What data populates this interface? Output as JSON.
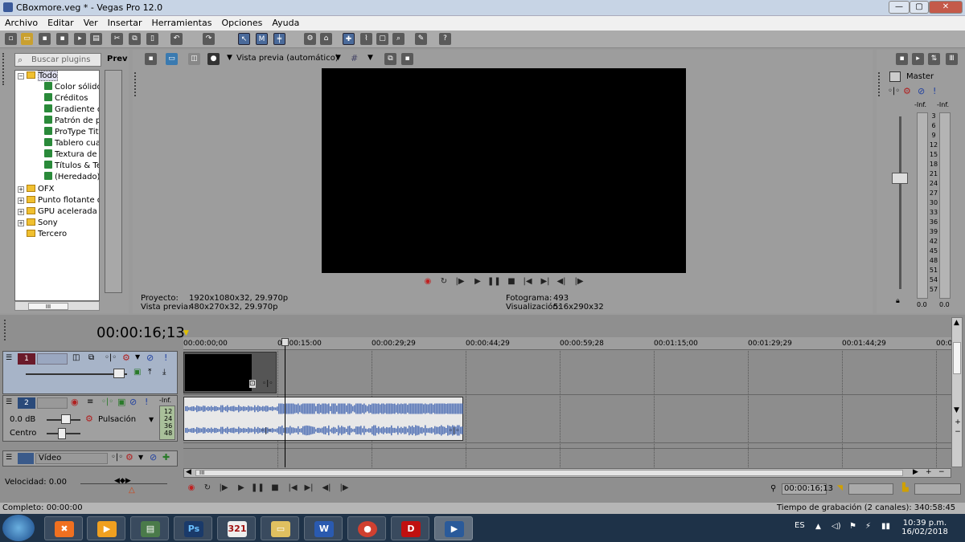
{
  "window": {
    "title": "CBoxmore.veg * - Vegas Pro 12.0",
    "minimize": "—",
    "maximize": "▢",
    "close": "✕"
  },
  "menu": [
    "Archivo",
    "Editar",
    "Ver",
    "Insertar",
    "Herramientas",
    "Opciones",
    "Ayuda"
  ],
  "plugins": {
    "search_placeholder": "Buscar plugins",
    "preview_label": "Prev",
    "tree": [
      {
        "label": "Todo",
        "type": "folder",
        "expanded": true,
        "selected": true
      },
      {
        "label": "Color sólido",
        "type": "fx"
      },
      {
        "label": "Créditos",
        "type": "fx"
      },
      {
        "label": "Gradiente de",
        "type": "fx"
      },
      {
        "label": "Patrón de pr",
        "type": "fx"
      },
      {
        "label": "ProType Title",
        "type": "fx"
      },
      {
        "label": "Tablero cuad",
        "type": "fx"
      },
      {
        "label": "Textura de r",
        "type": "fx"
      },
      {
        "label": "Títulos & Tex",
        "type": "fx"
      },
      {
        "label": "(Heredado) T",
        "type": "fx"
      },
      {
        "label": "OFX",
        "type": "folder"
      },
      {
        "label": "Punto flotante d",
        "type": "folder"
      },
      {
        "label": "GPU acelerada",
        "type": "folder"
      },
      {
        "label": "Sony",
        "type": "folder"
      },
      {
        "label": "Tercero",
        "type": "folder"
      }
    ],
    "scroll_thumb": "III"
  },
  "video_preview": {
    "mode": "Vista previa (automático)",
    "proyecto_label": "Proyecto:",
    "proyecto_value": "1920x1080x32, 29.970p",
    "vista_label": "Vista previa:",
    "vista_value": "480x270x32, 29.970p",
    "fotograma_label": "Fotograma:",
    "fotograma_value": "493",
    "visualizacion_label": "Visualización:",
    "visualizacion_value": "516x290x32"
  },
  "master": {
    "title": "Master",
    "inf_left": "-Inf.",
    "inf_right": "-Inf.",
    "scale": [
      "3",
      "6",
      "9",
      "12",
      "15",
      "18",
      "21",
      "24",
      "27",
      "30",
      "33",
      "36",
      "39",
      "42",
      "45",
      "48",
      "51",
      "54",
      "57"
    ],
    "val_left": "0.0",
    "val_right": "0.0"
  },
  "timeline": {
    "timecode": "00:00:16;13",
    "ruler": [
      "00:00:00;00",
      "00:00:15:00",
      "00:00:29;29",
      "00:00:44;29",
      "00:00:59;28",
      "00:01:15;00",
      "00:01:29;29",
      "00:01:44;29",
      "00:0"
    ],
    "track1": {
      "number": "1"
    },
    "track2": {
      "number": "2",
      "volume": "0.0 dB",
      "pan": "Centro",
      "mode": "Pulsación",
      "meter_inf": "-Inf.",
      "meter_scale": [
        "12",
        "24",
        "36",
        "48"
      ]
    },
    "track3": {
      "name": "Vídeo"
    },
    "velocity": "Velocidad: 0.00",
    "bottom_timecode": "00:00:16;13",
    "scroll_thumb": "III"
  },
  "status": {
    "complete": "Completo: 00:00:00",
    "recording": "Tiempo de grabación (2 canales): 340:58:45"
  },
  "taskbar": {
    "language": "ES",
    "time": "10:39 p.m.",
    "date": "16/02/2018"
  }
}
